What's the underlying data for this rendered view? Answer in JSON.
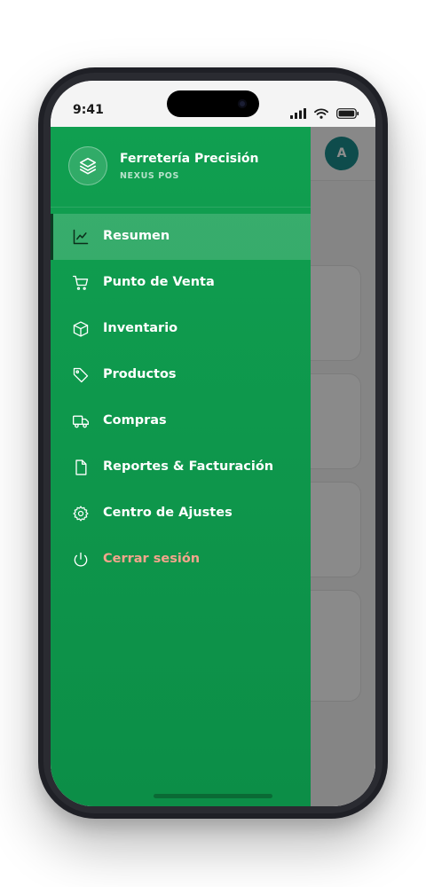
{
  "status_bar": {
    "time": "9:41"
  },
  "app": {
    "avatar_initial": "A"
  },
  "drawer": {
    "brand_name": "Ferretería Precisión",
    "brand_subtitle": "NEXUS POS",
    "logo_icon": "layers-icon",
    "items": [
      {
        "label": "Resumen",
        "icon": "chart-line-icon",
        "active": true
      },
      {
        "label": "Punto de Venta",
        "icon": "cart-icon",
        "active": false
      },
      {
        "label": "Inventario",
        "icon": "box-icon",
        "active": false
      },
      {
        "label": "Productos",
        "icon": "tag-icon",
        "active": false
      },
      {
        "label": "Compras",
        "icon": "truck-icon",
        "active": false
      },
      {
        "label": "Reportes & Facturación",
        "icon": "file-icon",
        "active": false
      },
      {
        "label": "Centro de Ajustes",
        "icon": "gear-icon",
        "active": false
      },
      {
        "label": "Cerrar sesión",
        "icon": "power-icon",
        "active": false
      }
    ]
  },
  "colors": {
    "drawer_green": "#109f50",
    "logout_text": "#f3a58c",
    "avatar_teal": "#1a8a8a"
  }
}
